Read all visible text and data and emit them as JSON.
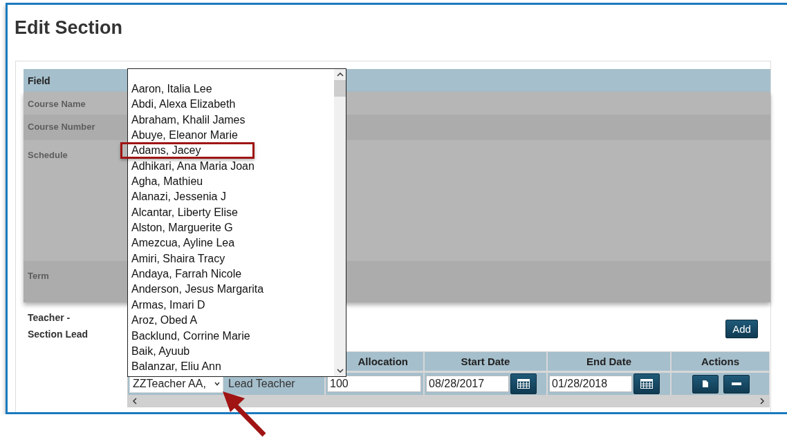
{
  "title": "Edit Section",
  "fields_table": {
    "columns": [
      "Field"
    ],
    "rows": [
      {
        "label": "Course Name",
        "kind": "short"
      },
      {
        "label": "Course Number",
        "kind": "medium"
      },
      {
        "label": "Schedule",
        "kind": "tall"
      },
      {
        "label": "Term",
        "kind": "wide"
      }
    ]
  },
  "teacher": {
    "label": "Teacher - Section Lead",
    "add_button": "Add",
    "table": {
      "columns": [
        "Allocation",
        "Start Date",
        "End Date",
        "Actions"
      ],
      "rows": [
        {
          "teacher": "ZZTeacher AA,",
          "role": "Lead Teacher",
          "allocation": "100",
          "start_date": "08/28/2017",
          "end_date": "01/28/2018"
        }
      ]
    }
  },
  "dropdown": {
    "options": [
      {
        "label": "Aaron, Italia Lee",
        "highlighted": false
      },
      {
        "label": "Abdi, Alexa Elizabeth",
        "highlighted": false
      },
      {
        "label": "Abraham, Khalil James",
        "highlighted": false
      },
      {
        "label": "Abuye, Eleanor Marie",
        "highlighted": false
      },
      {
        "label": "Adams, Jacey",
        "highlighted": true
      },
      {
        "label": "Adhikari, Ana Maria Joan",
        "highlighted": false
      },
      {
        "label": "Agha, Mathieu",
        "highlighted": false
      },
      {
        "label": "Alanazi, Jessenia J",
        "highlighted": false
      },
      {
        "label": "Alcantar, Liberty Elise",
        "highlighted": false
      },
      {
        "label": "Alston, Marguerite G",
        "highlighted": false
      },
      {
        "label": "Amezcua, Ayline Lea",
        "highlighted": false
      },
      {
        "label": "Amiri, Shaira Tracy",
        "highlighted": false
      },
      {
        "label": "Andaya, Farrah Nicole",
        "highlighted": false
      },
      {
        "label": "Anderson, Jesus Margarita",
        "highlighted": false
      },
      {
        "label": "Armas, Imari D",
        "highlighted": false
      },
      {
        "label": "Aroz, Obed A",
        "highlighted": false
      },
      {
        "label": "Backlund, Corrine Marie",
        "highlighted": false
      },
      {
        "label": "Baik, Ayuub",
        "highlighted": false
      },
      {
        "label": "Balanzar, Eliu Ann",
        "highlighted": false
      }
    ]
  }
}
